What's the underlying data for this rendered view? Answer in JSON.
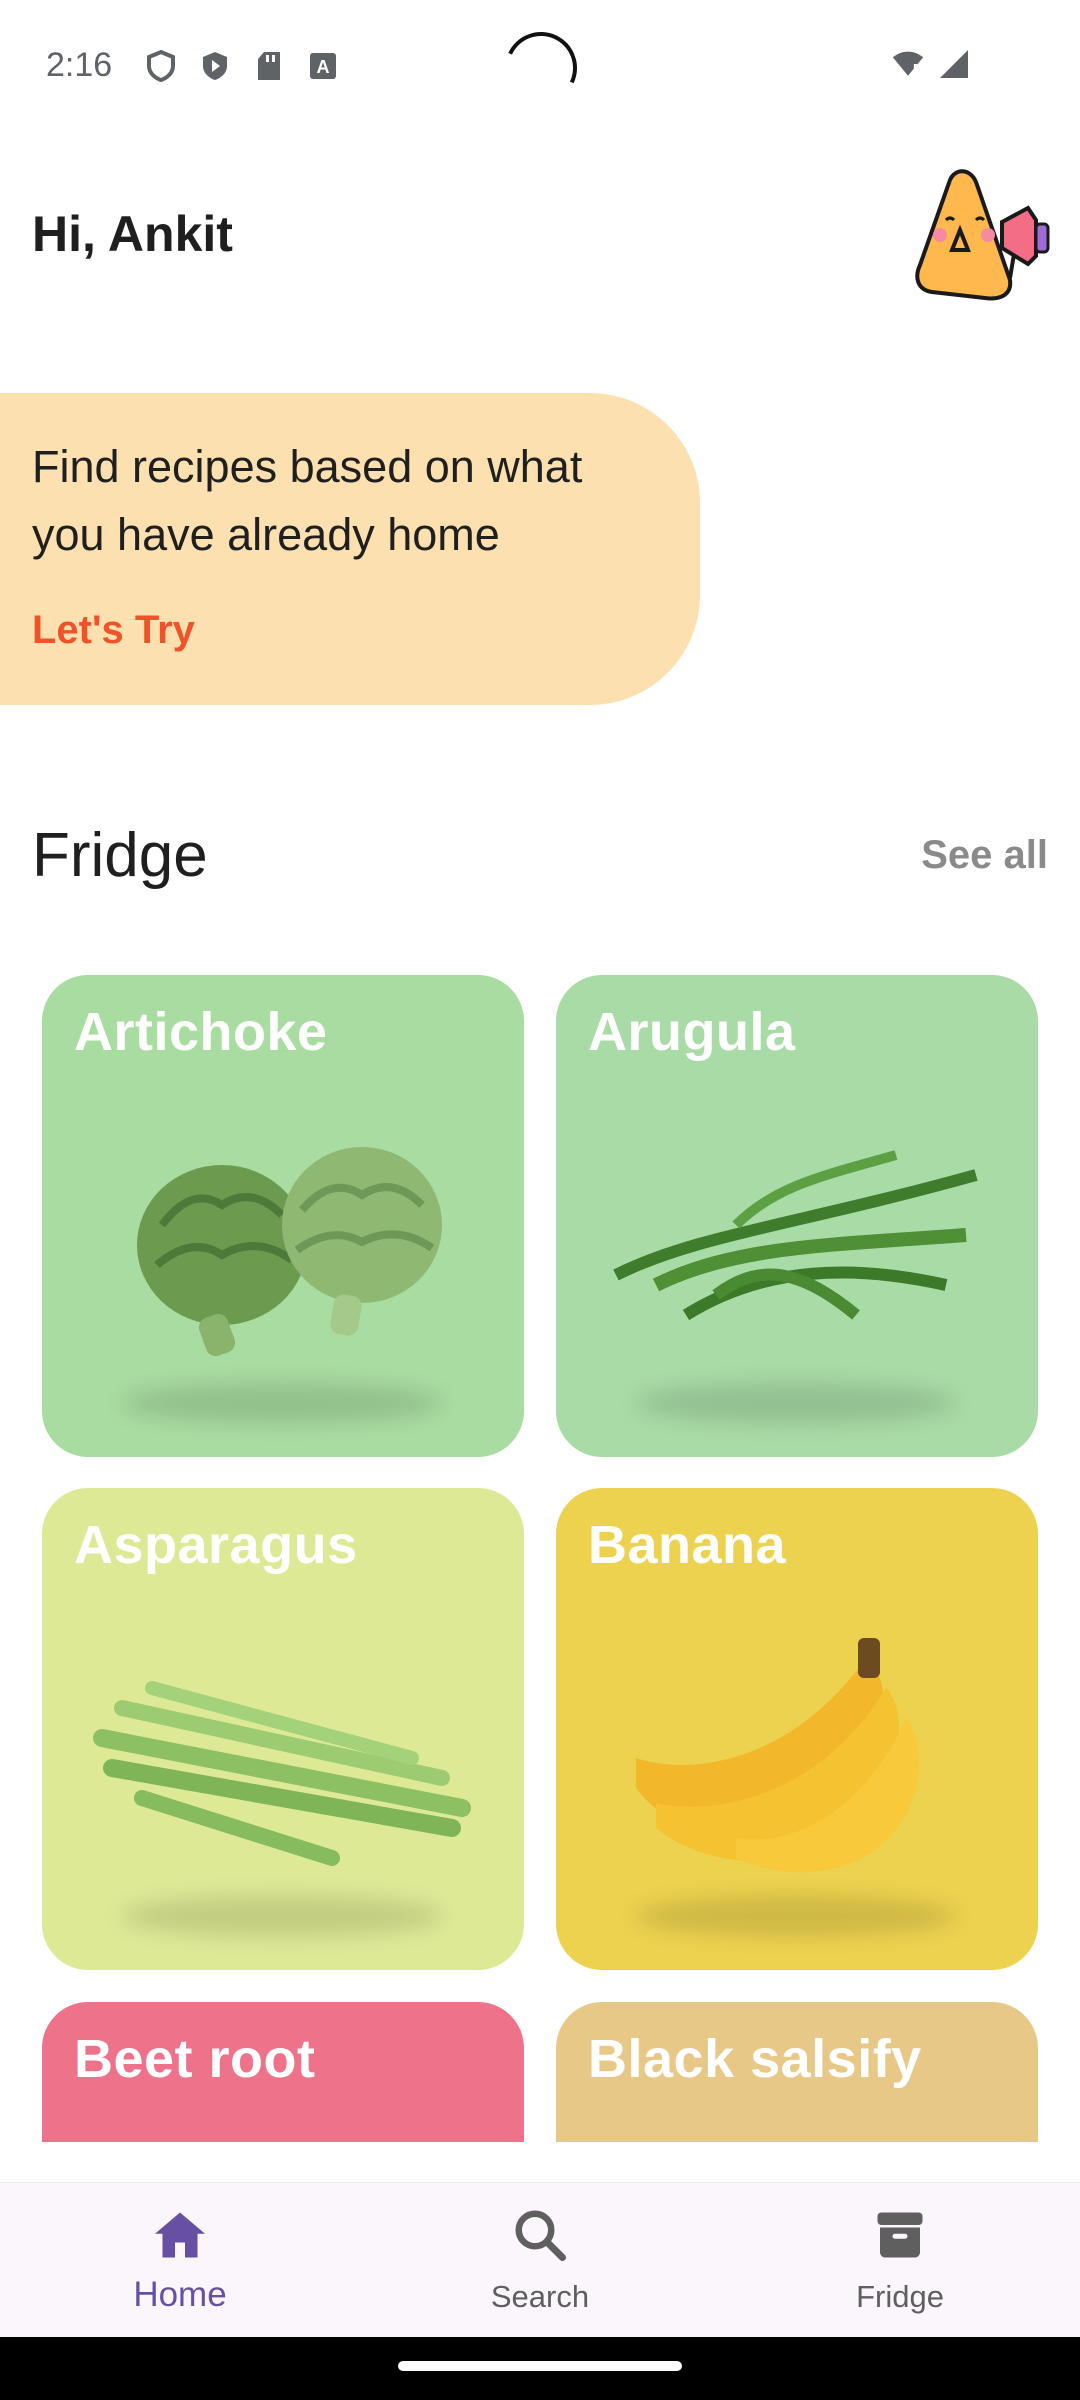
{
  "status_bar": {
    "time": "2:16",
    "left_icons": [
      "shield-icon",
      "play-protect-icon",
      "sd-card-icon",
      "text-a-icon"
    ],
    "right_icons": [
      "wifi-icon",
      "signal-icon"
    ]
  },
  "header": {
    "greeting": "Hi, Ankit",
    "avatar_icon": "megaphone-mascot-icon"
  },
  "promo": {
    "text": "Find recipes based on what you have already home",
    "cta": "Let's Try",
    "bg_color": "#fde0b0",
    "cta_color": "#f0532a"
  },
  "fridge": {
    "title": "Fridge",
    "see_all": "See all",
    "items": [
      {
        "name": "Artichoke",
        "color": "#a8dca0"
      },
      {
        "name": "Arugula",
        "color": "#a8dba6"
      },
      {
        "name": "Asparagus",
        "color": "#dde995"
      },
      {
        "name": "Banana",
        "color": "#ecd24f"
      },
      {
        "name": "Beet root",
        "color": "#ee7289"
      },
      {
        "name": "Black salsify",
        "color": "#e8c886"
      }
    ]
  },
  "bottom_nav": {
    "items": [
      {
        "label": "Home",
        "icon": "home-icon",
        "active": true
      },
      {
        "label": "Search",
        "icon": "search-icon",
        "active": false
      },
      {
        "label": "Fridge",
        "icon": "archive-icon",
        "active": false
      }
    ],
    "active_color": "#6750a4"
  }
}
